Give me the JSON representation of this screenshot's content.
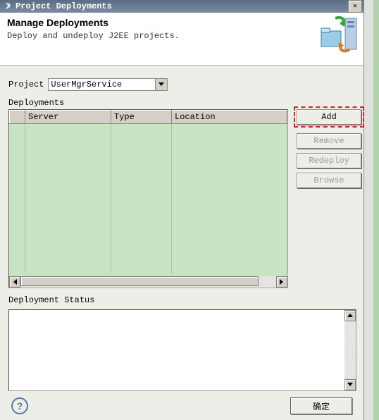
{
  "window": {
    "title": "Project Deployments"
  },
  "header": {
    "title": "Manage Deployments",
    "subtitle": "Deploy and undeploy J2EE projects."
  },
  "project": {
    "label": "Project",
    "value": "UserMgrService"
  },
  "deployments": {
    "label": "Deployments",
    "columns": {
      "server": "Server",
      "type": "Type",
      "location": "Location"
    }
  },
  "buttons": {
    "add": "Add",
    "remove": "Remove",
    "redeploy": "Redeploy",
    "browse": "Browse",
    "ok": "确定"
  },
  "status": {
    "label": "Deployment Status"
  }
}
